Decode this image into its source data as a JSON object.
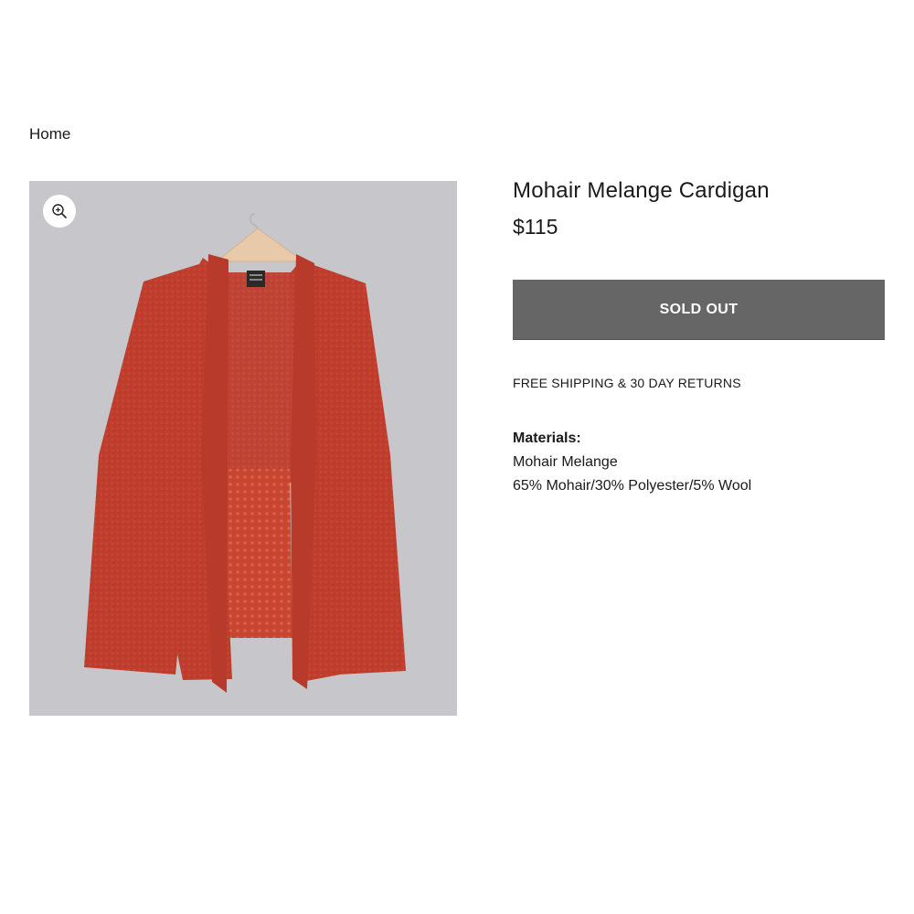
{
  "breadcrumb": {
    "home_label": "Home"
  },
  "gallery": {
    "zoom_icon": "zoom-in-icon",
    "image_subject": "product-photo",
    "background_color": "#c7c7cb",
    "garment_color": "#c23f2e"
  },
  "product": {
    "title": "Mohair Melange Cardigan",
    "price": "$115",
    "button_label": "SOLD OUT",
    "button_color": "#666666",
    "shipping_note": "FREE SHIPPING & 30 DAY RETURNS",
    "materials": {
      "label": "Materials:",
      "lines": [
        "Mohair Melange",
        "65% Mohair/30% Polyester/5% Wool"
      ]
    }
  }
}
